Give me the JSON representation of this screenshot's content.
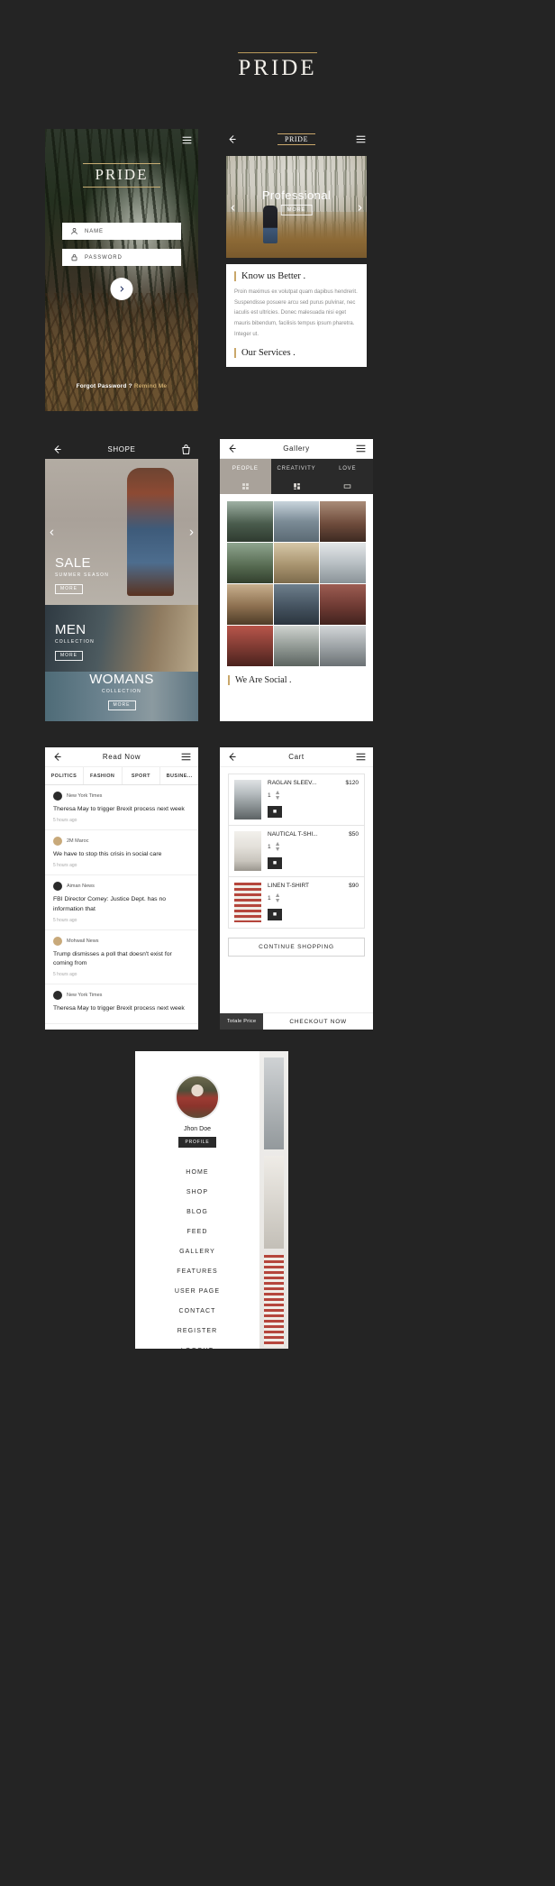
{
  "brand": {
    "word": "PRIDE"
  },
  "login": {
    "logo": "PRIDE",
    "fields": [
      {
        "icon": "user-icon",
        "placeholder": "NAME"
      },
      {
        "icon": "lock-icon",
        "placeholder": "PASSWORD"
      }
    ],
    "submit_icon": "chevron-right-icon",
    "forgot_text": "Forgot Password ?",
    "forgot_link": "Remind Me"
  },
  "about": {
    "title": "PRIDE",
    "back_icon": "back-arrow-icon",
    "menu_icon": "hamburger-icon",
    "hero": {
      "title": "Professional",
      "button": "MORE",
      "prev": "‹",
      "next": "›"
    },
    "sections": [
      {
        "heading": "Know us Better .",
        "body": "Proin maximus ex volutpat quam dapibus hendrerit. Suspendisse posuere arcu sed purus pulvinar, nec iaculis est ultricies. Donec malesuada nisi eget mauris bibendum, facilisis tempus ipsum pharetra. Integer ut."
      },
      {
        "heading": "Our Services .",
        "body": ""
      }
    ]
  },
  "shop": {
    "title": "SHOPE",
    "back_icon": "back-arrow-icon",
    "cart_icon": "shopping-bag-icon",
    "slides": [
      {
        "title": "SALE",
        "subtitle": "SUMMER SEASON",
        "button": "MORE",
        "prev": "‹",
        "next": "›"
      },
      {
        "title": "MEN",
        "subtitle": "COLLECTION",
        "button": "MORE"
      },
      {
        "title": "WOMANS",
        "subtitle": "COLLECTION",
        "button": "MORE"
      }
    ]
  },
  "gallery": {
    "title": "Gallery",
    "back_icon": "back-arrow-icon",
    "menu_icon": "hamburger-icon",
    "tabs": [
      {
        "label": "PEOPLE",
        "active": true
      },
      {
        "label": "CREATIVITY",
        "active": false
      },
      {
        "label": "LOVE",
        "active": false
      }
    ],
    "icon_tabs": [
      {
        "icon": "grid-icon",
        "active": true
      },
      {
        "icon": "masonry-icon",
        "active": false
      },
      {
        "icon": "wide-icon",
        "active": false
      }
    ],
    "footer_heading": "We Are Social ."
  },
  "news": {
    "title": "Read Now",
    "back_icon": "back-arrow-icon",
    "menu_icon": "hamburger-icon",
    "tabs": [
      "POLITICS",
      "FASHION",
      "SPORT",
      "BUSINE..."
    ],
    "items": [
      {
        "source": "New York Times",
        "headline": "Theresa May to trigger Brexit process next week",
        "time": "5 hours ago",
        "color": "#2b2b2b"
      },
      {
        "source": "2M Maroc",
        "headline": "We have to stop this crisis in social care",
        "time": "5 hours ago",
        "color": "#c8a97a"
      },
      {
        "source": "Aiman News",
        "headline": "FBI Director Comey: Justice Dept. has no information that",
        "time": "5 hours ago",
        "color": "#2b2b2b"
      },
      {
        "source": "Mohwail News",
        "headline": "Trump dismisses a poll that doesn't exist for coming from",
        "time": "5 hours ago",
        "color": "#c8a97a"
      },
      {
        "source": "New York Times",
        "headline": "Theresa May to trigger Brexit process next week",
        "time": "5 hours ago",
        "color": "#2b2b2b"
      }
    ]
  },
  "cart": {
    "title": "Cart",
    "back_icon": "back-arrow-icon",
    "menu_icon": "hamburger-icon",
    "items": [
      {
        "name": "RAGLAN SLEEV...",
        "price": "$120",
        "qty": "1",
        "delete_icon": "trash-icon"
      },
      {
        "name": "NAUTICAL T-SHI...",
        "price": "$50",
        "qty": "1",
        "delete_icon": "trash-icon"
      },
      {
        "name": "LINEN T-SHIRT",
        "price": "$90",
        "qty": "1",
        "delete_icon": "trash-icon"
      }
    ],
    "continue_label": "CONTINUE SHOPPING",
    "total_label": "Totale Price",
    "checkout_label": "CHECKOUT NOW"
  },
  "menu": {
    "user_name": "Jhon Doe",
    "profile_button": "PROFILE",
    "links": [
      "HOME",
      "SHOP",
      "BLOG",
      "FEED",
      "GALLERY",
      "FEATURES",
      "USER PAGE",
      "CONTACT",
      "REGISTER",
      "LOGOUT"
    ]
  },
  "colors": {
    "background": "#242424",
    "gold": "#c9a76a",
    "card": "#ffffff",
    "dark": "#2a2a2a"
  }
}
